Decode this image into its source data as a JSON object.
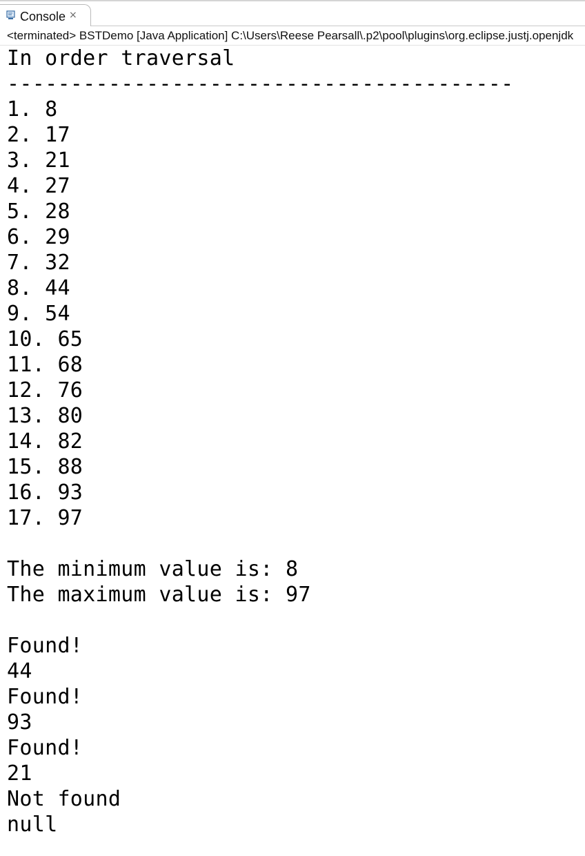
{
  "tab": {
    "icon": "console-icon",
    "label": "Console",
    "close_glyph": "×"
  },
  "status": "<terminated> BSTDemo [Java Application] C:\\Users\\Reese Pearsall\\.p2\\pool\\plugins\\org.eclipse.justj.openjdk",
  "console": {
    "lines": [
      "In order traversal",
      "----------------------------------------",
      "1. 8",
      "2. 17",
      "3. 21",
      "4. 27",
      "5. 28",
      "6. 29",
      "7. 32",
      "8. 44",
      "9. 54",
      "10. 65",
      "11. 68",
      "12. 76",
      "13. 80",
      "14. 82",
      "15. 88",
      "16. 93",
      "17. 97",
      "",
      "The minimum value is: 8",
      "The maximum value is: 97",
      "",
      "Found!",
      "44",
      "Found!",
      "93",
      "Found!",
      "21",
      "Not found",
      "null"
    ]
  },
  "colors": {
    "background": "#ffffff",
    "text": "#000000",
    "tab_border": "#b9b9b9",
    "icon_blue": "#3a6ea5"
  }
}
